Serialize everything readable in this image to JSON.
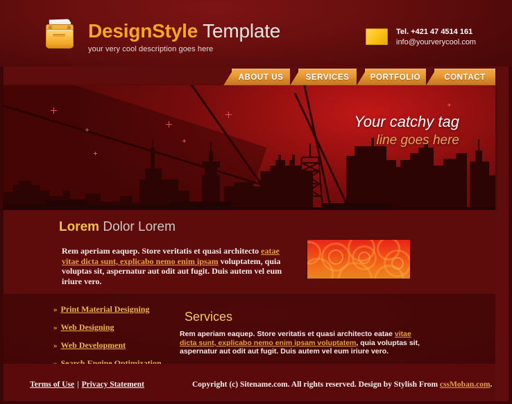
{
  "header": {
    "logo_icon": "folder-icon",
    "brand_bold": "DesignStyle",
    "brand_light": " Template",
    "tagline": "your very cool description goes here",
    "mail_icon": "envelope-icon",
    "phone": "Tel. +421 47 4514 161",
    "email": "info@yourverycool.com"
  },
  "nav": {
    "items": [
      {
        "label": "ABOUT US"
      },
      {
        "label": "SERVICES"
      },
      {
        "label": "PORTFOLIO"
      },
      {
        "label": "CONTACT"
      }
    ]
  },
  "hero": {
    "tag_line1": "Your catchy tag",
    "tag_line2": "line goes here",
    "image_name": "city-skyline-silhouette"
  },
  "content": {
    "heading_gold": "Lorem",
    "heading_grey": " Dolor Lorem",
    "paragraph1": {
      "t1": "Rem aperiam eaquep. Store veritatis et quasi architecto ",
      "link1": "eatae vitae dicta sunt, explicabo nemo enim ipsam",
      "t2": " voluptatem, quia voluptas sit, aspernatur aut odit aut fugit. Duis autem vel eum iriure vero."
    },
    "decorative_image": "orange-swirl-banner"
  },
  "services": {
    "heading": "Services",
    "links": [
      {
        "label": "Print Material Designing",
        "bullet": "»"
      },
      {
        "label": "Web Designing",
        "bullet": "»"
      },
      {
        "label": "Web Development",
        "bullet": "»"
      },
      {
        "label": "Search Engine Optimization",
        "bullet": "»"
      }
    ],
    "paragraph2": {
      "t1": "Rem aperiam eaquep. Store veritatis et quasi architecto eatae ",
      "link1": "vitae dicta sunt, explicabo nemo enim ipsam voluptatem",
      "t2": ", quia voluptas sit, aspernatur aut odit aut fugit. Duis autem vel eum iriure vero."
    }
  },
  "footer": {
    "terms_label": "Terms of Use",
    "separator": "|",
    "privacy_label": "Privacy Statement",
    "copyright_text": "Copyright (c) Sitename.com. All rights reserved. Design by Stylish From ",
    "copyright_link": "cssMoban.com",
    "copyright_end": "."
  },
  "colors": {
    "page_bg": "#5e0c0c",
    "frame": "#3d0606",
    "accent_orange": "#e89b33",
    "gold": "#f2c14e",
    "link_gold": "#eeb44f",
    "hero_red": "#c21717",
    "dark_panel": "#470707"
  }
}
